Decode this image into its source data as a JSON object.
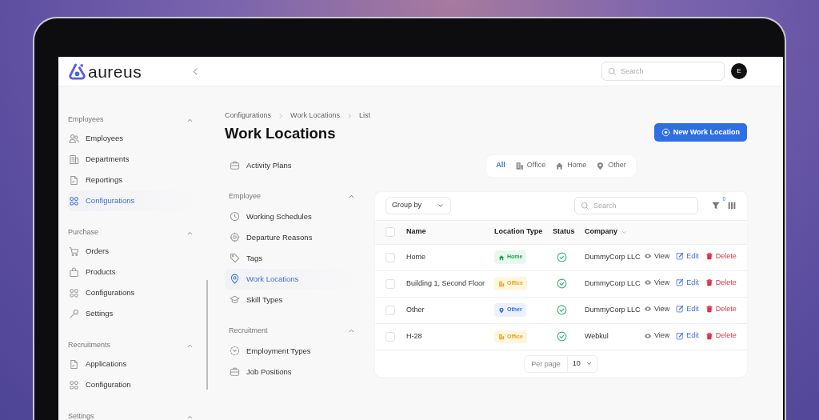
{
  "header": {
    "logo": "aureus",
    "search": {
      "placeholder": "Search"
    },
    "avatar": "E"
  },
  "sidebar": {
    "groups": [
      {
        "title": "Employees",
        "expanded": true,
        "items": [
          {
            "label": "Employees",
            "selected": false
          },
          {
            "label": "Departments",
            "selected": false
          },
          {
            "label": "Reportings",
            "selected": false
          },
          {
            "label": "Configurations",
            "selected": true
          }
        ]
      },
      {
        "title": "Purchase",
        "expanded": true,
        "items": [
          {
            "label": "Orders",
            "selected": false
          },
          {
            "label": "Products",
            "selected": false
          },
          {
            "label": "Configurations",
            "selected": false
          },
          {
            "label": "Settings",
            "selected": false
          }
        ]
      },
      {
        "title": "Recruitments",
        "expanded": true,
        "items": [
          {
            "label": "Applications",
            "selected": false
          },
          {
            "label": "Configuration",
            "selected": false
          }
        ]
      },
      {
        "title": "Settings",
        "expanded": true
      }
    ]
  },
  "breadcrumb": [
    "Configurations",
    "Work Locations",
    "List"
  ],
  "page_title": "Work Locations",
  "new_button": "New Work Location",
  "subnav": {
    "sections": [
      {
        "items": [
          {
            "label": "Activity Plans",
            "selected": false
          }
        ]
      },
      {
        "title": "Employee",
        "expanded": true,
        "items": [
          {
            "label": "Working Schedules",
            "selected": false
          },
          {
            "label": "Departure Reasons",
            "selected": false
          },
          {
            "label": "Tags",
            "selected": false
          },
          {
            "label": "Work Locations",
            "selected": true
          },
          {
            "label": "Skill Types",
            "selected": false
          }
        ]
      },
      {
        "title": "Recruitment",
        "expanded": true,
        "items": [
          {
            "label": "Employment Types",
            "selected": false
          },
          {
            "label": "Job Positions",
            "selected": false
          }
        ]
      }
    ]
  },
  "filter_tabs": [
    {
      "label": "All",
      "selected": true
    },
    {
      "label": "Office",
      "selected": false
    },
    {
      "label": "Home",
      "selected": false
    },
    {
      "label": "Other",
      "selected": false
    }
  ],
  "toolbar": {
    "group_by": "Group by",
    "search": {
      "placeholder": "Search"
    },
    "filter_count": "0"
  },
  "table": {
    "header_checked": false,
    "columns": [
      "Name",
      "Location Type",
      "Status",
      "Company"
    ],
    "rows": [
      {
        "checked": false,
        "name": "Home",
        "location_type": {
          "kind": "home",
          "label": "Home"
        },
        "active": true,
        "company": "DummyCorp LLC",
        "actions": [
          "View",
          "Edit",
          "Delete"
        ]
      },
      {
        "checked": false,
        "name": "Building 1, Second Floor",
        "location_type": {
          "kind": "office",
          "label": "Office"
        },
        "active": true,
        "company": "DummyCorp LLC",
        "actions": [
          "View",
          "Edit",
          "Delete"
        ]
      },
      {
        "checked": false,
        "name": "Other",
        "location_type": {
          "kind": "other",
          "label": "Other"
        },
        "active": true,
        "company": "DummyCorp LLC",
        "actions": [
          "View",
          "Edit",
          "Delete"
        ]
      },
      {
        "checked": false,
        "name": "H-28",
        "location_type": {
          "kind": "office",
          "label": "Office"
        },
        "active": true,
        "company": "Webkul",
        "actions": [
          "View",
          "Edit",
          "Delete"
        ]
      }
    ]
  },
  "pagination": {
    "label": "Per page",
    "value": "10"
  }
}
